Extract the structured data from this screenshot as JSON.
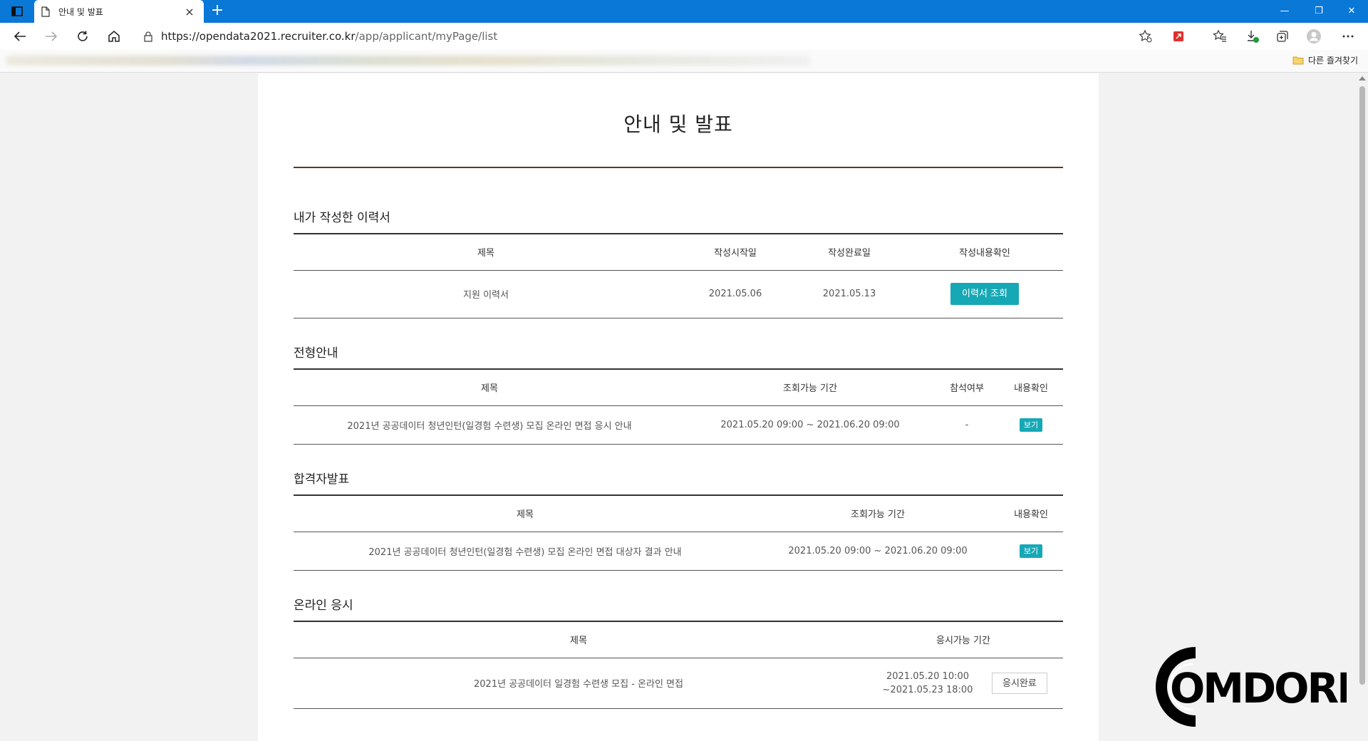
{
  "browser": {
    "tab_title": "안내 및 발표",
    "tab_close": "×",
    "new_tab": "+",
    "url_host": "https://opendata2021.recruiter.co.kr",
    "url_path": "/app/applicant/myPage/list",
    "other_favorites": "다른 즐겨찾기",
    "controls": {
      "minimize": "—",
      "restore": "❐",
      "close": "✕"
    }
  },
  "page": {
    "title": "안내 및 발표"
  },
  "resume": {
    "title": "내가 작성한 이력서",
    "headers": [
      "제목",
      "작성시작일",
      "작성완료일",
      "작성내용확인"
    ],
    "rows": [
      {
        "name": "지원 이력서",
        "start": "2021.05.06",
        "end": "2021.05.13",
        "button": "이력서 조회"
      }
    ]
  },
  "screening": {
    "title": "전형안내",
    "headers": [
      "제목",
      "조회가능 기간",
      "참석여부",
      "내용확인"
    ],
    "rows": [
      {
        "name": "2021년 공공데이터 청년인턴(일경험 수련생) 모집 온라인 면접 응시 안내",
        "period": "2021.05.20 09:00 ~ 2021.06.20 09:00",
        "attend": "-",
        "button": "보기"
      }
    ]
  },
  "results": {
    "title": "합격자발표",
    "headers": [
      "제목",
      "조회가능 기간",
      "내용확인"
    ],
    "rows": [
      {
        "name": "2021년 공공데이터 청년인턴(일경험 수련생) 모집 온라인 면접 대상자 결과 안내",
        "period": "2021.05.20 09:00 ~ 2021.06.20 09:00",
        "button": "보기"
      }
    ]
  },
  "online": {
    "title": "온라인 응시",
    "headers": [
      "제목",
      "응시가능 기간"
    ],
    "rows": [
      {
        "name": "2021년 공공데이터 일경험 수련생 모집 - 온라인 면접",
        "period_start": "2021.05.20 10:00",
        "period_end": "~2021.05.23 18:00",
        "button": "응시완료"
      }
    ]
  },
  "watermark": {
    "text": "OMDORI"
  }
}
